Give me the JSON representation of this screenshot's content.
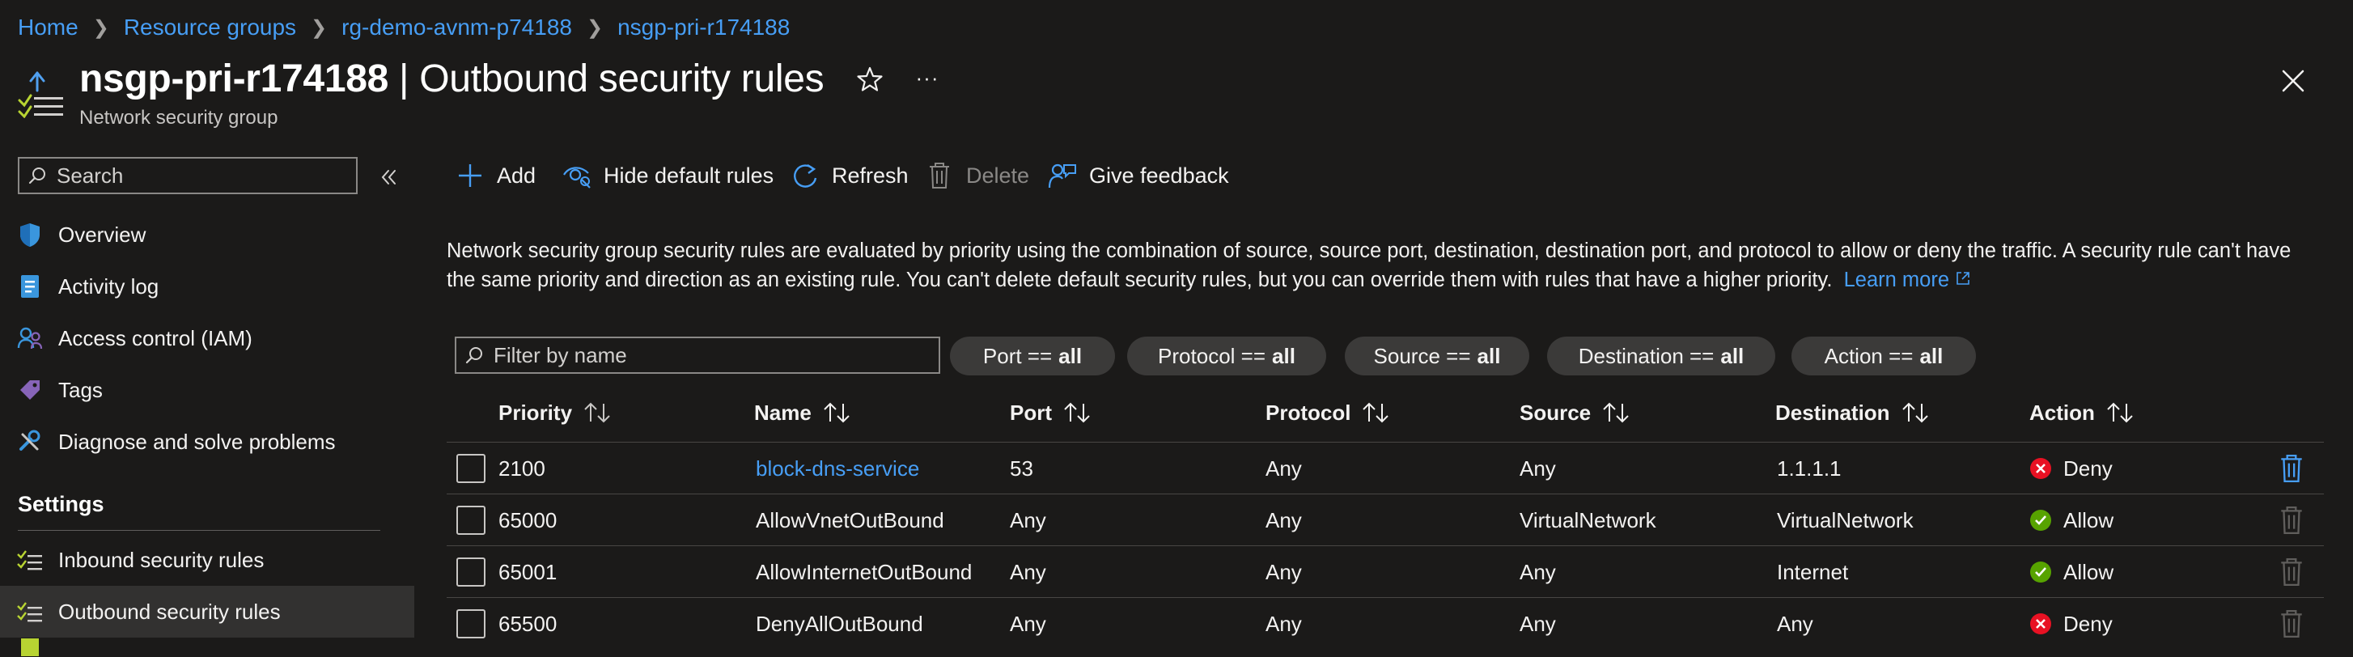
{
  "breadcrumb": [
    {
      "label": "Home"
    },
    {
      "label": "Resource groups"
    },
    {
      "label": "rg-demo-avnm-p74188"
    },
    {
      "label": "nsgp-pri-r174188"
    }
  ],
  "header": {
    "resource_name": "nsgp-pri-r174188",
    "separator": " | ",
    "blade": "Outbound security rules",
    "subtitle": "Network security group",
    "favorite_icon": "star-icon",
    "more_label": "···"
  },
  "sidebar": {
    "search_placeholder": "Search",
    "items": [
      {
        "label": "Overview",
        "icon": "shield-icon"
      },
      {
        "label": "Activity log",
        "icon": "activity-log-icon"
      },
      {
        "label": "Access control (IAM)",
        "icon": "people-icon"
      },
      {
        "label": "Tags",
        "icon": "tag-icon"
      },
      {
        "label": "Diagnose and solve problems",
        "icon": "wrench-icon"
      }
    ],
    "section_title": "Settings",
    "settings_items": [
      {
        "label": "Inbound security rules",
        "icon": "inbound-rules-icon"
      },
      {
        "label": "Outbound security rules",
        "icon": "outbound-rules-icon",
        "active": true
      }
    ]
  },
  "toolbar": {
    "add": "Add",
    "hide_default": "Hide default rules",
    "refresh": "Refresh",
    "delete": "Delete",
    "feedback": "Give feedback"
  },
  "description": {
    "text": "Network security group security rules are evaluated by priority using the combination of source, source port, destination, destination port, and protocol to allow or deny the traffic. A security rule can't have the same priority and direction as an existing rule. You can't delete default security rules, but you can override them with rules that have a higher priority.",
    "learn_more": "Learn more"
  },
  "filters": {
    "placeholder": "Filter by name",
    "pills": [
      {
        "label": "Port ==",
        "value": "all"
      },
      {
        "label": "Protocol ==",
        "value": "all"
      },
      {
        "label": "Source ==",
        "value": "all"
      },
      {
        "label": "Destination ==",
        "value": "all"
      },
      {
        "label": "Action ==",
        "value": "all"
      }
    ]
  },
  "table": {
    "columns": [
      "Priority",
      "Name",
      "Port",
      "Protocol",
      "Source",
      "Destination",
      "Action"
    ],
    "rows": [
      {
        "priority": "2100",
        "name": "block-dns-service",
        "port": "53",
        "protocol": "Any",
        "source": "Any",
        "destination": "1.1.1.1",
        "action": "Deny",
        "is_link": true
      },
      {
        "priority": "65000",
        "name": "AllowVnetOutBound",
        "port": "Any",
        "protocol": "Any",
        "source": "VirtualNetwork",
        "destination": "VirtualNetwork",
        "action": "Allow",
        "is_link": false
      },
      {
        "priority": "65001",
        "name": "AllowInternetOutBound",
        "port": "Any",
        "protocol": "Any",
        "source": "Any",
        "destination": "Internet",
        "action": "Allow",
        "is_link": false
      },
      {
        "priority": "65500",
        "name": "DenyAllOutBound",
        "port": "Any",
        "protocol": "Any",
        "source": "Any",
        "destination": "Any",
        "action": "Deny",
        "is_link": false
      }
    ]
  },
  "colors": {
    "link": "#479ef5",
    "deny": "#e81123",
    "allow": "#57a300"
  }
}
